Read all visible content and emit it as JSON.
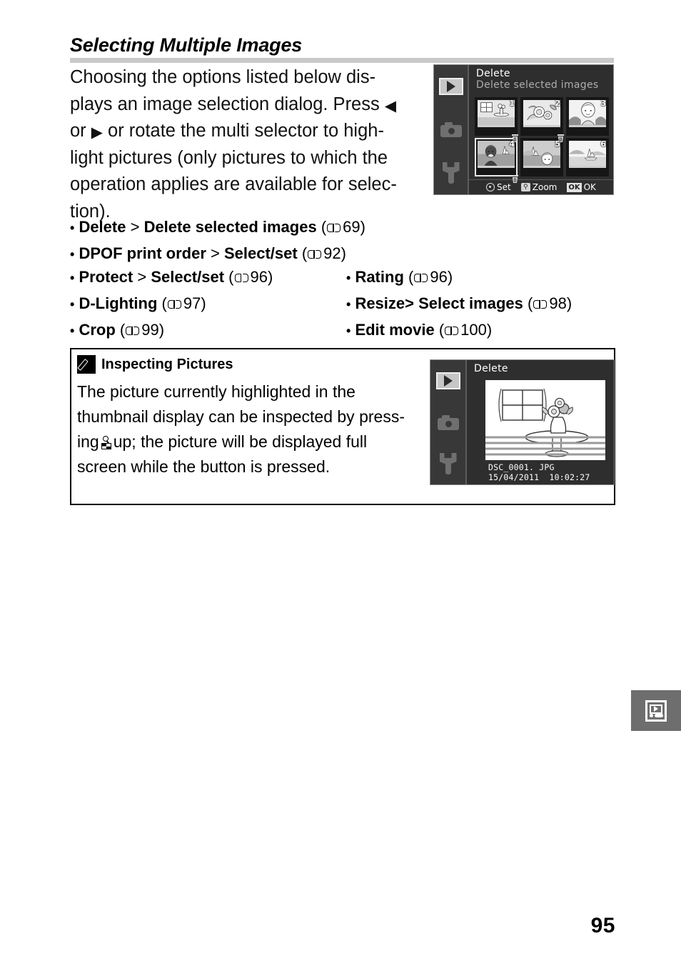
{
  "page": {
    "number": "95",
    "section_heading": "Selecting Multiple Images"
  },
  "intro": {
    "lines": [
      "Choosing the options listed below dis-",
      "plays an image selection dialog.  Press ",
      "or  or rotate the multi selector to high-",
      "light pictures (only pictures to which the",
      "operation applies are available for selec-",
      "tion)."
    ],
    "left_arrow": "◀",
    "right_arrow": "▶"
  },
  "bullets_full": [
    {
      "bullet": "•",
      "name": "Delete",
      "sep": " > ",
      "sub": "Delete selected images",
      "page": "69"
    },
    {
      "bullet": "•",
      "name": "DPOF print order",
      "sep": " > ",
      "sub": "Select/set",
      "page": "92"
    }
  ],
  "bullets_left": [
    {
      "bullet": "•",
      "name": "Protect",
      "sep": " > ",
      "sub": "Select/set",
      "page": "96"
    },
    {
      "bullet": "•",
      "name": "D-Lighting",
      "sep": "",
      "sub": "",
      "page": "97"
    },
    {
      "bullet": "•",
      "name": "Crop",
      "sep": "",
      "sub": "",
      "page": "99"
    }
  ],
  "bullets_right": [
    {
      "bullet": "•",
      "name": "Rating",
      "sep": "",
      "sub": "",
      "page": "96"
    },
    {
      "bullet": "•",
      "name": "Resize",
      "sep": "> ",
      "sub": "Select images",
      "page": "98"
    },
    {
      "bullet": "•",
      "name": "Edit movie",
      "sep": "",
      "sub": "",
      "page": "100"
    }
  ],
  "note": {
    "title": "Inspecting Pictures",
    "badge_icon": "pencil-icon",
    "lines": [
      "The   picture   currently   highlighted   in   the",
      "thumbnail display can be inspected by press-",
      "ing",
      "up; the  picture  will  be  displayed  full",
      "screen while the button is pressed."
    ],
    "line3_prefix": "ing",
    "line3_suffix": "up;  the  picture  will  be  displayed  full",
    "zoom_glyph": "thumbnail-zoom-button-icon"
  },
  "lcd_top": {
    "title": "Delete",
    "subtitle": "Delete selected images",
    "sidebar_icons": [
      "playback-icon",
      "shooting-menu-icon",
      "setup-menu-icon"
    ],
    "active_sidebar_index": 0,
    "thumbnails": [
      {
        "num": "1",
        "marked": true,
        "highlighted": false,
        "motif": "table-vase"
      },
      {
        "num": "2",
        "marked": true,
        "highlighted": false,
        "motif": "flowers"
      },
      {
        "num": "3",
        "marked": false,
        "highlighted": false,
        "motif": "portrait"
      },
      {
        "num": "4",
        "marked": true,
        "highlighted": true,
        "motif": "woman-boat"
      },
      {
        "num": "5",
        "marked": false,
        "highlighted": false,
        "motif": "boat-child"
      },
      {
        "num": "6",
        "marked": false,
        "highlighted": false,
        "motif": "landscape-boat"
      }
    ],
    "statusbar": [
      {
        "glyph": "multi-selector-icon",
        "label": "Set"
      },
      {
        "glyph": "zoom-button-icon",
        "label": "Zoom"
      },
      {
        "glyph": "ok-button-icon",
        "label": "OK"
      }
    ]
  },
  "lcd_bottom": {
    "title": "Delete",
    "sidebar_icons": [
      "playback-icon",
      "shooting-menu-icon",
      "setup-menu-icon"
    ],
    "active_sidebar_index": 0,
    "filename": "DSC_0001. JPG",
    "timestamp": "15/04/2011  10:02:27"
  },
  "corner_tab": {
    "icon": "playback-monitor-icon"
  },
  "colors": {
    "rule": "#c9c9c9",
    "lcd_bg": "#2e2e2e",
    "lcd_sidebar": "#383838",
    "lcd_title_text": "#ffffff",
    "lcd_subtitle_text": "#aeaeae",
    "tab_bg": "#6e6e6e",
    "text": "#000000"
  }
}
